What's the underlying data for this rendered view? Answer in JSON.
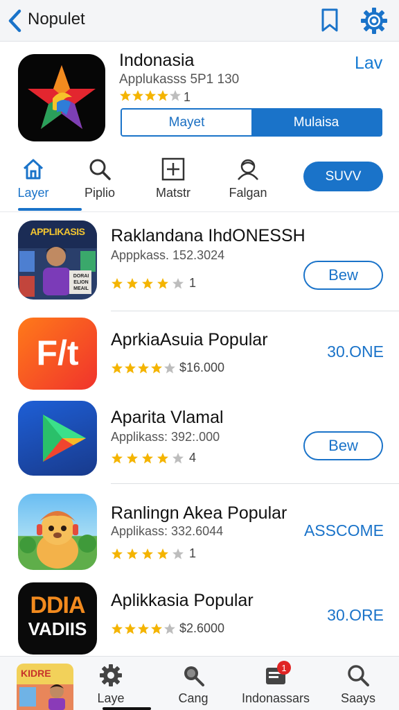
{
  "header": {
    "title": "Nopulet",
    "back_icon": "chevron-left-icon",
    "bookmark_icon": "bookmark-icon",
    "settings_icon": "gear-icon",
    "accent_color": "#1a73c9"
  },
  "featured": {
    "name": "Indonasia",
    "subtitle": "Applukasss 5P1 130",
    "rating_stars": 4,
    "rating_count": "1",
    "link_label": "Lav",
    "segment": [
      "Mayet",
      "Mulaisa"
    ]
  },
  "tabs": [
    {
      "label": "Layer",
      "icon": "home-icon",
      "active": true
    },
    {
      "label": "Piplio",
      "icon": "search-icon",
      "active": false
    },
    {
      "label": "Matstr",
      "icon": "add-box-icon",
      "active": false
    },
    {
      "label": "Falgan",
      "icon": "profile-icon",
      "active": false
    }
  ],
  "pill_button": "SUVV",
  "apps": [
    {
      "name": "Raklandana IhdONESSH",
      "subtitle": "Apppkass. 152.3024",
      "stars": 4,
      "rating_text": "1",
      "action": "Bew",
      "action_type": "button",
      "icon_title": "APPLIKASIS",
      "icon_caption": [
        "DORAI",
        "ELION",
        "MEAIL"
      ]
    },
    {
      "name": "AprkiaAsuia Popular",
      "subtitle": "",
      "stars": 4,
      "rating_text": "$16.000",
      "action": "30.ONE",
      "action_type": "price",
      "icon_glyph": "F/t"
    },
    {
      "name": "Aparita Vlamal",
      "subtitle": "Applikass: 392:.000",
      "stars": 4,
      "rating_text": "4",
      "action": "Bew",
      "action_type": "button"
    },
    {
      "name": "Ranlingn Akea Popular",
      "subtitle": "Applikass: 332.6044",
      "stars": 4,
      "rating_text": "1",
      "action": "ASSCOME",
      "action_type": "price"
    },
    {
      "name": "Aplikkasia Popular",
      "subtitle": "",
      "stars": 4,
      "rating_text": "$2.6000",
      "action": "30.ORE",
      "action_type": "price",
      "icon_title": "DDIA",
      "icon_subtitle": "VADIIS"
    }
  ],
  "bottom_nav": {
    "thumb_text": "KIDRE",
    "items": [
      {
        "label": "Laye",
        "icon": "gear-icon"
      },
      {
        "label": "Cang",
        "icon": "search-icon"
      },
      {
        "label": "Indonassars",
        "icon": "inbox-icon",
        "badge": "1"
      },
      {
        "label": "Saays",
        "icon": "search-icon"
      }
    ]
  }
}
